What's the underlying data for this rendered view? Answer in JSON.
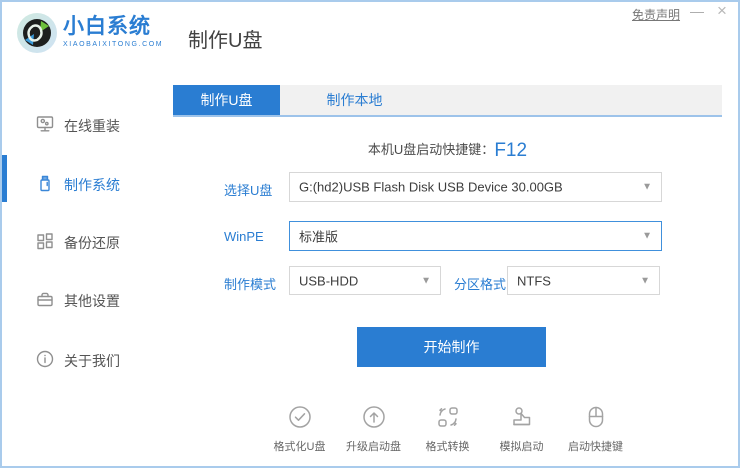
{
  "window": {
    "disclaimer": "免责声明",
    "minimize": "—",
    "close": "×"
  },
  "header": {
    "logo_title": "小白系统",
    "logo_subtitle": "XIAOBAIXITONG.COM",
    "page_title": "制作U盘"
  },
  "sidebar": {
    "items": [
      {
        "label": "在线重装",
        "icon": "monitor-icon",
        "active": false
      },
      {
        "label": "制作系统",
        "icon": "usb-icon",
        "active": true
      },
      {
        "label": "备份还原",
        "icon": "grid-icon",
        "active": false
      },
      {
        "label": "其他设置",
        "icon": "briefcase-icon",
        "active": false
      },
      {
        "label": "关于我们",
        "icon": "info-icon",
        "active": false
      }
    ]
  },
  "main": {
    "tabs": [
      {
        "label": "制作U盘",
        "active": true
      },
      {
        "label": "制作本地",
        "active": false
      }
    ],
    "hotkey_label": "本机U盘启动快捷键：",
    "hotkey_value": "F12",
    "form": {
      "usb_label": "选择U盘",
      "usb_value": "G:(hd2)USB Flash Disk USB Device 30.00GB",
      "winpe_label": "WinPE",
      "winpe_value": "标准版",
      "mode_label": "制作模式",
      "mode_value": "USB-HDD",
      "partition_label": "分区格式",
      "partition_value": "NTFS"
    },
    "start_button": "开始制作",
    "tools": [
      {
        "label": "格式化U盘",
        "icon": "check-circle-icon"
      },
      {
        "label": "升级启动盘",
        "icon": "arrow-up-circle-icon"
      },
      {
        "label": "格式转换",
        "icon": "convert-icon"
      },
      {
        "label": "模拟启动",
        "icon": "stamp-icon"
      },
      {
        "label": "启动快捷键",
        "icon": "mouse-icon"
      }
    ]
  },
  "colors": {
    "primary_blue": "#2a7dd2",
    "tab_underline_blue": "#9dc3ea",
    "window_border_blue": "#a9cbec",
    "winpe_focus_border": "#4090dc",
    "icon_gray": "#9a9a9a"
  }
}
